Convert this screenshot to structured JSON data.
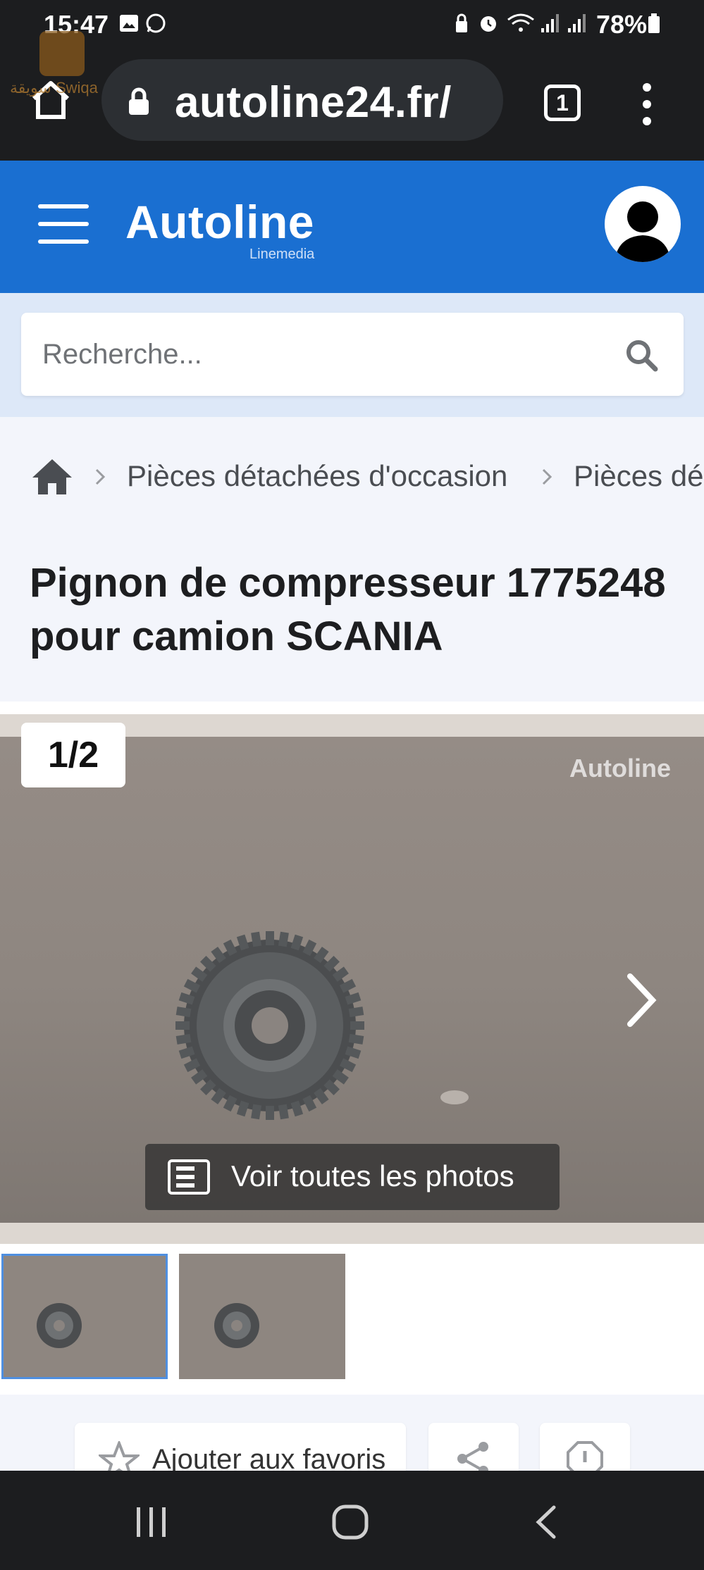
{
  "status_bar": {
    "time": "15:47",
    "battery": "78%"
  },
  "browser": {
    "url": "autoline24.fr/",
    "tab_count": "1"
  },
  "watermark": {
    "text": "سويقة Swiqa"
  },
  "header": {
    "brand": "Autoline",
    "brand_sub": "Linemedia"
  },
  "search": {
    "placeholder": "Recherche..."
  },
  "breadcrumb": {
    "items": [
      "Pièces détachées d'occasion",
      "Pièces dé"
    ]
  },
  "title": "Pignon de compresseur 1775248 pour camion SCANIA",
  "gallery": {
    "counter": "1/2",
    "photo_watermark": "Autoline",
    "all_photos_label": "Voir toutes les photos"
  },
  "actions": {
    "favorite_label": "Ajouter aux favoris"
  },
  "colors": {
    "brand_blue": "#1a6fd1",
    "chrome_dark": "#1c1d1f",
    "search_band": "#dde8f8"
  }
}
